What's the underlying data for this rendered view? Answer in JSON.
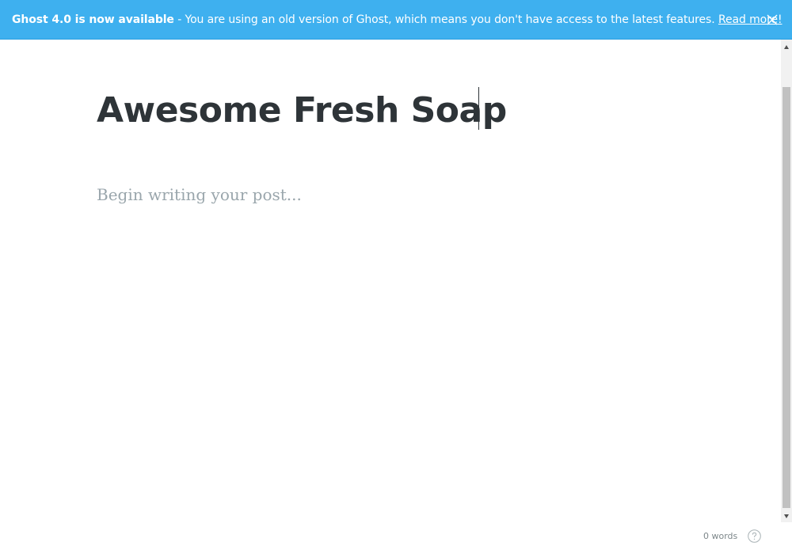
{
  "banner": {
    "headline": "Ghost 4.0 is now available",
    "message": " - You are using an old version of Ghost, which means you don't have access to the latest features. ",
    "link_label": "Read more!",
    "close_icon": "close-icon",
    "background_color": "#3eb0ef"
  },
  "editor": {
    "title_value": "Awesome Fresh Soap",
    "body_placeholder": "Begin writing your post...",
    "word_count": "0 words",
    "help_icon": "question-mark-icon"
  }
}
